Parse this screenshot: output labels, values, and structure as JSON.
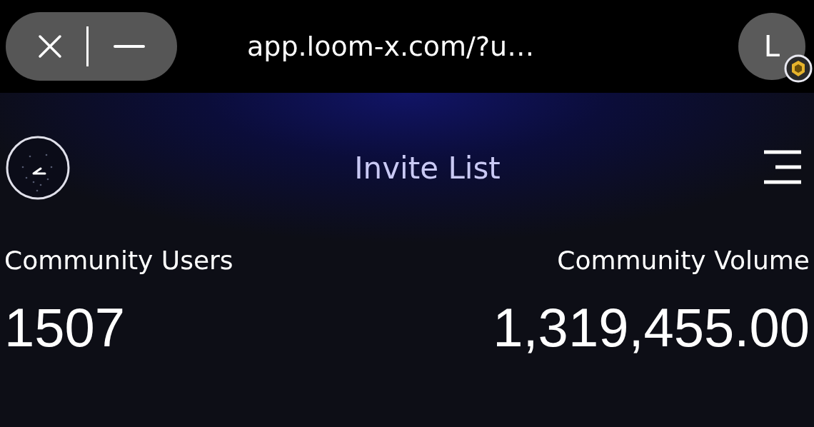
{
  "browser_bar": {
    "url": "app.loom-x.com/?u…",
    "avatar_letter": "L"
  },
  "header": {
    "title": "Invite List"
  },
  "stats": [
    {
      "label": "Community Users",
      "value": "1507"
    },
    {
      "label": "Community Volume",
      "value": "1,319,455.00"
    }
  ]
}
